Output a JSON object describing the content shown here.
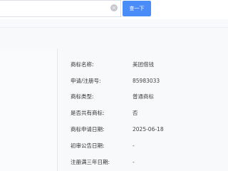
{
  "search": {
    "value": "",
    "clear_icon": "×",
    "button_label": "查一下"
  },
  "details": {
    "rows": [
      {
        "label": "商标名称:",
        "value": "美团借钱"
      },
      {
        "label": "申请/注册号:",
        "value": "85983033"
      },
      {
        "label": "商标类型:",
        "value": "普通商标"
      },
      {
        "label": "是否共有商标:",
        "value": "否"
      },
      {
        "label": "商标申请日期:",
        "value": "2025-06-18"
      },
      {
        "label": "初审公告日期:",
        "value": "-"
      },
      {
        "label": "注册满三年日期:",
        "value": "-"
      }
    ]
  },
  "colors": {
    "accent": "#4b8df8"
  }
}
